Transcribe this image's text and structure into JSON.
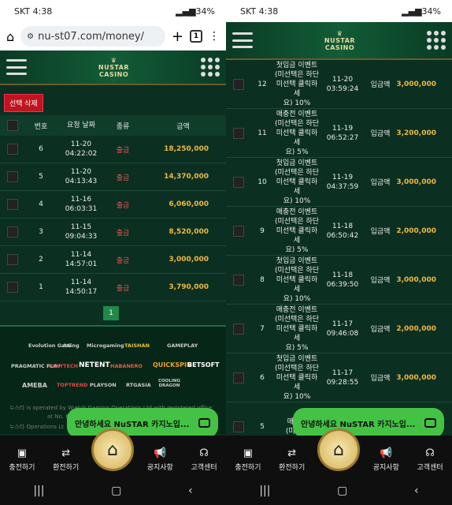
{
  "status": {
    "time": "4:38",
    "carrier": "SKT",
    "battery": "34%"
  },
  "browser": {
    "url": "nu-st07.com/money/",
    "tabs": "1"
  },
  "left": {
    "delete_btn": "선택 삭제",
    "headers": [
      "번호",
      "요청 날짜",
      "종류",
      "금액"
    ],
    "rows": [
      {
        "no": "6",
        "date": "11-20",
        "time": "04:22:02",
        "type": "출금",
        "amount": "18,250,000"
      },
      {
        "no": "5",
        "date": "11-20",
        "time": "04:13:43",
        "type": "출금",
        "amount": "14,370,000"
      },
      {
        "no": "4",
        "date": "11-16",
        "time": "06:03:31",
        "type": "출금",
        "amount": "6,060,000"
      },
      {
        "no": "3",
        "date": "11-15",
        "time": "09:04:33",
        "type": "출금",
        "amount": "8,520,000"
      },
      {
        "no": "2",
        "date": "11-14",
        "time": "14:57:01",
        "type": "출금",
        "amount": "3,000,000"
      },
      {
        "no": "1",
        "date": "11-14",
        "time": "14:50:17",
        "type": "출금",
        "amount": "3,790,000"
      }
    ],
    "page": "1",
    "providers": [
      "Evolution Gaming",
      "AG",
      "Microgaming",
      "TAISHAN",
      "GAMEPLAY",
      "PRAGMATIC PLAY",
      "PLAYTECH",
      "NETENT",
      "HABANERO",
      "QUICKSPIN",
      "BETSOFT",
      "AMEBA",
      "TOPTREND",
      "PLAYSON",
      "RTGASIA",
      "COOLING DRAGON"
    ],
    "footer1": "누스타 is operated by W-Hub Gaming Operations Ltd with registered office",
    "footer2": "at No. 6/",
    "footer3": "누스타 Operations Lt"
  },
  "right": {
    "rows": [
      {
        "no": "12",
        "t1": "첫입금 이벤트",
        "t2": "(미선택은 하단",
        "t3": "미선택 클릭하세",
        "t4": "요) 10%",
        "date": "11-20",
        "time": "03:59:24",
        "type": "입금액",
        "amount": "3,000,000"
      },
      {
        "no": "11",
        "t1": "매충전 이벤트",
        "t2": "(미선택은 하단",
        "t3": "미선택 클릭하세",
        "t4": "요) 5%",
        "date": "11-19",
        "time": "06:52:27",
        "type": "입금액",
        "amount": "3,200,000"
      },
      {
        "no": "10",
        "t1": "첫입금 이벤트",
        "t2": "(미선택은 하단",
        "t3": "미선택 클릭하세",
        "t4": "요) 10%",
        "date": "11-19",
        "time": "04:37:59",
        "type": "입금액",
        "amount": "3,000,000"
      },
      {
        "no": "9",
        "t1": "매충전 이벤트",
        "t2": "(미선택은 하단",
        "t3": "미선택 클릭하세",
        "t4": "요) 5%",
        "date": "11-18",
        "time": "06:50:42",
        "type": "입금액",
        "amount": "2,000,000"
      },
      {
        "no": "8",
        "t1": "첫입금 이벤트",
        "t2": "(미선택은 하단",
        "t3": "미선택 클릭하세",
        "t4": "요) 10%",
        "date": "11-18",
        "time": "06:39:50",
        "type": "입금액",
        "amount": "3,000,000"
      },
      {
        "no": "7",
        "t1": "매충전 이벤트",
        "t2": "(미선택은 하단",
        "t3": "미선택 클릭하세",
        "t4": "요) 5%",
        "date": "11-17",
        "time": "09:46:08",
        "type": "입금액",
        "amount": "2,000,000"
      },
      {
        "no": "6",
        "t1": "첫입금 이벤트",
        "t2": "(미선택은 하단",
        "t3": "미선택 클릭하세",
        "t4": "요) 10%",
        "date": "11-17",
        "time": "09:28:55",
        "type": "입금액",
        "amount": "3,000,000"
      },
      {
        "no": "5",
        "t1": "매충전",
        "t2": "(미선택",
        "t3": "",
        "t4": "",
        "date": "",
        "time": "",
        "type": "",
        "amount": ""
      }
    ]
  },
  "logo": {
    "line1": "NUSTAR",
    "line2": "CASINO"
  },
  "chat": "안녕하세요 NuSTAR 카지노입...",
  "nav": [
    "충전하기",
    "환전하기",
    "공지사항",
    "고객센터"
  ],
  "colors": {
    "bg": "#0b2f21",
    "amount": "#f0b840",
    "withdraw": "#f05050",
    "chat": "#44c244"
  }
}
